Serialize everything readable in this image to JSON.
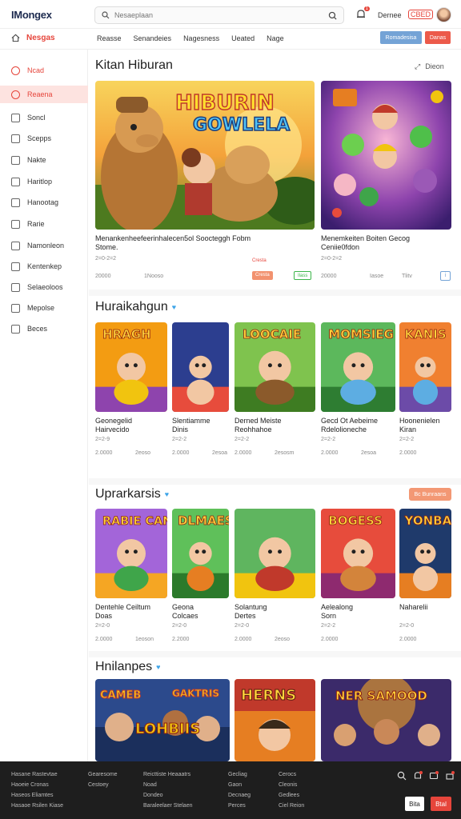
{
  "header": {
    "logo_main": "IMongex",
    "search_placeholder": "Nesaeplaan",
    "notification_count": "1",
    "user_name": "Dernee",
    "user_badge": "CBED"
  },
  "subnav": {
    "home_label": "Nesgas",
    "links": [
      "Reasse",
      "Senandeies",
      "Nagesness",
      "Ueated",
      "Nage"
    ],
    "btn_blue": "Romadesisa",
    "btn_red": "Danas"
  },
  "sidebar": {
    "items": [
      {
        "label": "Ncad"
      },
      {
        "label": "Reaena"
      },
      {
        "label": "Soncl"
      },
      {
        "label": "Scepps"
      },
      {
        "label": "Nakte"
      },
      {
        "label": "Haritlop"
      },
      {
        "label": "Hanootag"
      },
      {
        "label": "Rarie"
      },
      {
        "label": "Namonleon"
      },
      {
        "label": "Kentenkep"
      },
      {
        "label": "Selaeoloos"
      },
      {
        "label": "Mepolse"
      },
      {
        "label": "Beces"
      }
    ]
  },
  "sections": {
    "s1": {
      "title": "Kitan Hiburan",
      "right_label": "Dieon",
      "cards": [
        {
          "title1": "Menankenheefeerinhalecen5ol Soocteggh Fobm",
          "title2": "Stome.",
          "sub": "2=0-2=2",
          "meta_left": "20000",
          "meta_mid": "1Nooso",
          "tag_text": "Cresta",
          "tag2": "Ilass",
          "logo_text_1": "HIBURIN",
          "logo_text_2": "GOWLELA"
        },
        {
          "title1": "Menemkeiten Boiten Gecog",
          "title2": "Ceniie0fdon",
          "sub": "2=0-2=2",
          "meta_left": "20000",
          "meta_mid": "Iasoe",
          "meta_right": "Tlitv"
        }
      ]
    },
    "s2": {
      "title": "Huraikahgun",
      "cards": [
        {
          "l1": "Geonegelid",
          "l2": "Hairvecido",
          "sub": "2=2-9",
          "meta": "2.0000",
          "meta_r": "2eoso",
          "art_text": "HRAGH"
        },
        {
          "l1": "Slentiamme",
          "l2": "Dinis",
          "sub": "2=2-2",
          "meta": "2.0000",
          "meta_r": "2esoa"
        },
        {
          "l1": "Derned Meiste",
          "l2": "Reohhahoe",
          "sub": "2=2-2",
          "meta": "2.0000",
          "meta_r": "2esosm",
          "art_text": "LOOCAIE"
        },
        {
          "l1": "Gecd Ot Aebeime",
          "l2": "Rdelolioneche",
          "sub": "2=2-2",
          "meta": "2.0000",
          "meta_r": "2esoa",
          "art_text": "MOMSIEG"
        },
        {
          "l1": "Hoonenielen",
          "l2": "Kiran",
          "sub": "2=2-2",
          "meta": "2.0000",
          "art_text": "KANIS"
        }
      ]
    },
    "s3": {
      "title": "Uprarkarsis",
      "btn": "Bc Bunraans",
      "cards": [
        {
          "l1": "Dentehle Ceiltum",
          "l2": "Doas",
          "sub": "2=2-0",
          "meta": "2.0000",
          "meta_r": "1eoson",
          "art_text": "RABIE CANS"
        },
        {
          "l1": "Geona",
          "l2": "Colcaes",
          "sub": "2=2-0",
          "meta": "2.2000",
          "art_text": "DLMAES"
        },
        {
          "l1": "Solantung",
          "l2": "Dertes",
          "sub": "2=2-0",
          "meta": "2.0000",
          "meta_r": "2eoso"
        },
        {
          "l1": "Aelealong",
          "l2": "Sorn",
          "sub": "2=2-2",
          "meta": "2.0000",
          "art_text": "BOGESS"
        },
        {
          "l1": "Naharelii",
          "l2": "",
          "sub": "2=2-0",
          "meta": "2.0000",
          "art_text": "YONBAN"
        }
      ]
    },
    "s4": {
      "title": "Hnilanpes",
      "cards": [
        {
          "art_text_1": "CAMEB",
          "art_text_2": "GAKTRIS",
          "art_text_3": "LOHBIIS"
        },
        {
          "art_text": "HERNS"
        },
        {
          "art_text": "NER SAMOOD"
        }
      ]
    }
  },
  "footer": {
    "col1": [
      "Hasane Rastevtae",
      "Haoeie Cronas",
      "Haseos Eliamtes",
      "Hasaoe Rsilen Kiase"
    ],
    "col2": [
      "Gearesome",
      "Cestoey"
    ],
    "col3": [
      "Reicttiste Heaaatrs",
      "Noad",
      "Dondeo",
      "Baraleelaer Stelaen"
    ],
    "col4": [
      "Gecliag",
      "Gaon",
      "Decnaeg",
      "Perces"
    ],
    "col5": [
      "Cerocs",
      "Cleonis",
      "Gedlees",
      "Ciel Reion"
    ],
    "btn1": "Bita",
    "btn2": "Btal"
  },
  "colors": {
    "accent": "#e6453b",
    "blue": "#74a3d6",
    "footer_bg": "#1e1e1e"
  }
}
